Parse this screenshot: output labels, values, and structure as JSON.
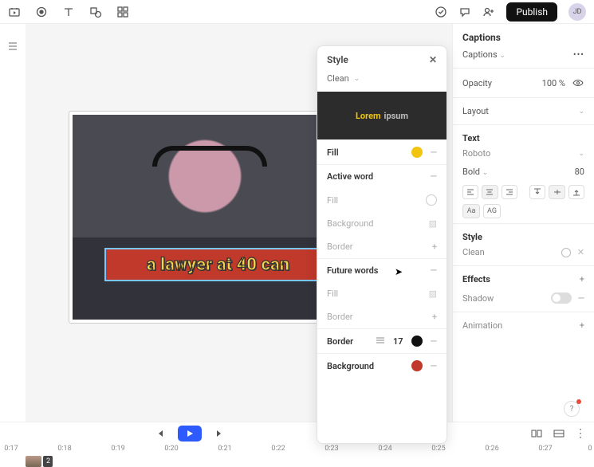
{
  "topbar": {
    "publish": "Publish",
    "avatar_initials": "JD"
  },
  "caption_overlay": "a lawyer at 40 can",
  "style_panel": {
    "title": "Style",
    "preset": "Clean",
    "preview_word1": "Lorem",
    "preview_word2": "ipsum",
    "rows": {
      "fill": "Fill",
      "active_word": "Active word",
      "aw_fill": "Fill",
      "aw_background": "Background",
      "aw_border": "Border",
      "future_words": "Future words",
      "fw_fill": "Fill",
      "fw_border": "Border",
      "border": "Border",
      "border_value": "17",
      "background": "Background"
    }
  },
  "right_panel": {
    "title": "Captions",
    "captions_dropdown": "Captions",
    "opacity_label": "Opacity",
    "opacity_value": "100 %",
    "layout": "Layout",
    "text_head": "Text",
    "font": "Roboto",
    "weight": "Bold",
    "font_size": "80",
    "case_mixed": "Aa",
    "case_upper": "AG",
    "style_head": "Style",
    "style_name": "Clean",
    "effects_head": "Effects",
    "shadow": "Shadow",
    "animation": "Animation"
  },
  "timeline": {
    "marks": [
      "0:17",
      "0:18",
      "0:19",
      "0:20",
      "0:21",
      "0:22",
      "0:23",
      "0:24",
      "0:25",
      "0:26",
      "0:27",
      "0"
    ],
    "clip_label": "2"
  },
  "help": "?"
}
